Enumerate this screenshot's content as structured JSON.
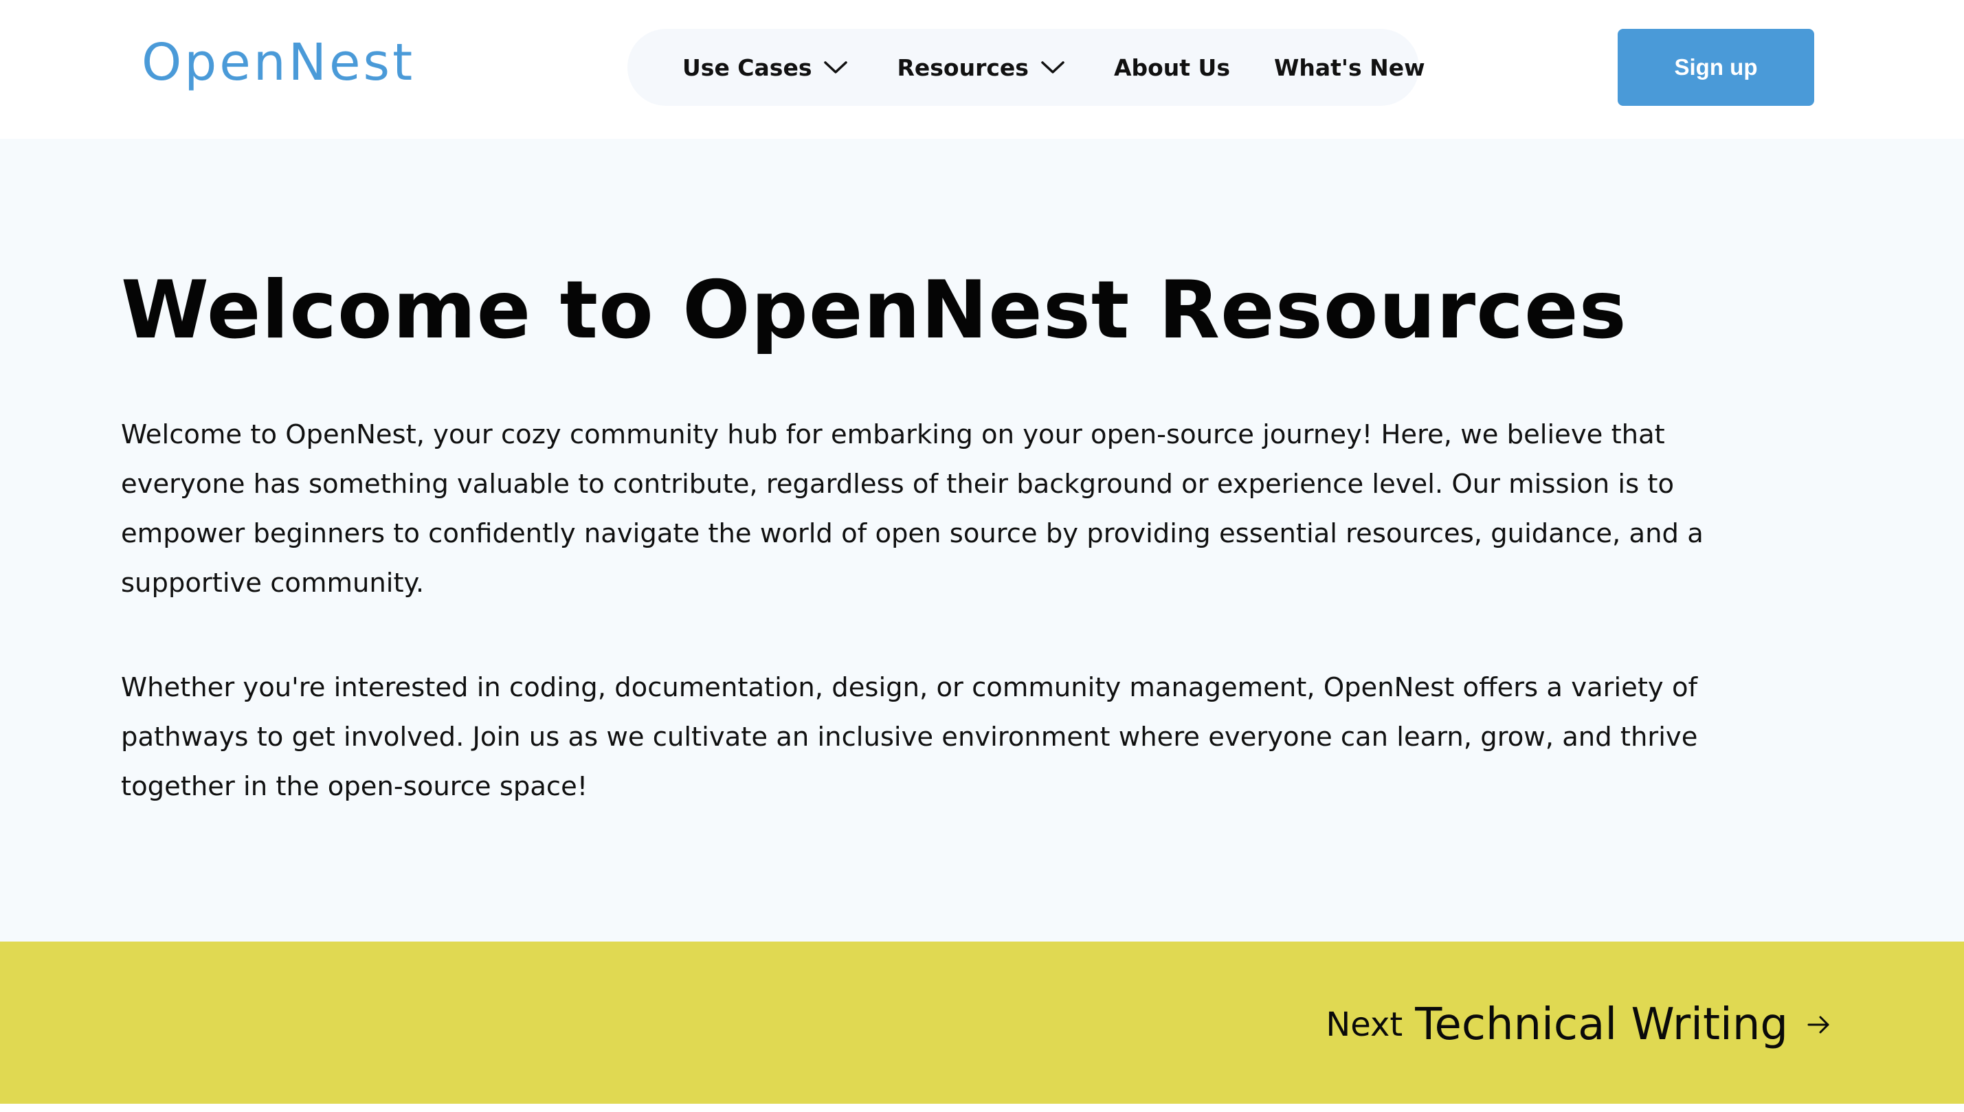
{
  "brand": {
    "logo_text": "OpenNest",
    "accent_color": "#4a9ad8",
    "next_bar_color": "#e0d952",
    "hero_bg_color": "#f6fafd"
  },
  "nav": {
    "items": [
      {
        "label": "Use Cases",
        "has_dropdown": true,
        "icon": "chevron-down-icon"
      },
      {
        "label": "Resources",
        "has_dropdown": true,
        "icon": "chevron-down-icon"
      },
      {
        "label": "About Us",
        "has_dropdown": false
      },
      {
        "label": "What's New",
        "has_dropdown": false
      }
    ],
    "signup_label": "Sign up"
  },
  "hero": {
    "title": "Welcome to OpenNest Resources",
    "paragraphs": [
      "Welcome to OpenNest, your cozy community hub for embarking on your open-source journey! Here, we believe that everyone has something valuable to contribute, regardless of their background or experience level. Our mission is to empower beginners to confidently navigate the world of open source by providing essential resources, guidance, and a supportive community.",
      "Whether you're interested in coding, documentation, design, or community management, OpenNest offers a variety of pathways to get involved. Join us as we cultivate an inclusive environment where everyone can learn, grow, and thrive together in the open-source space!"
    ]
  },
  "pager": {
    "next_label": "Next",
    "next_title": "Technical Writing",
    "icon": "arrow-right-icon"
  }
}
